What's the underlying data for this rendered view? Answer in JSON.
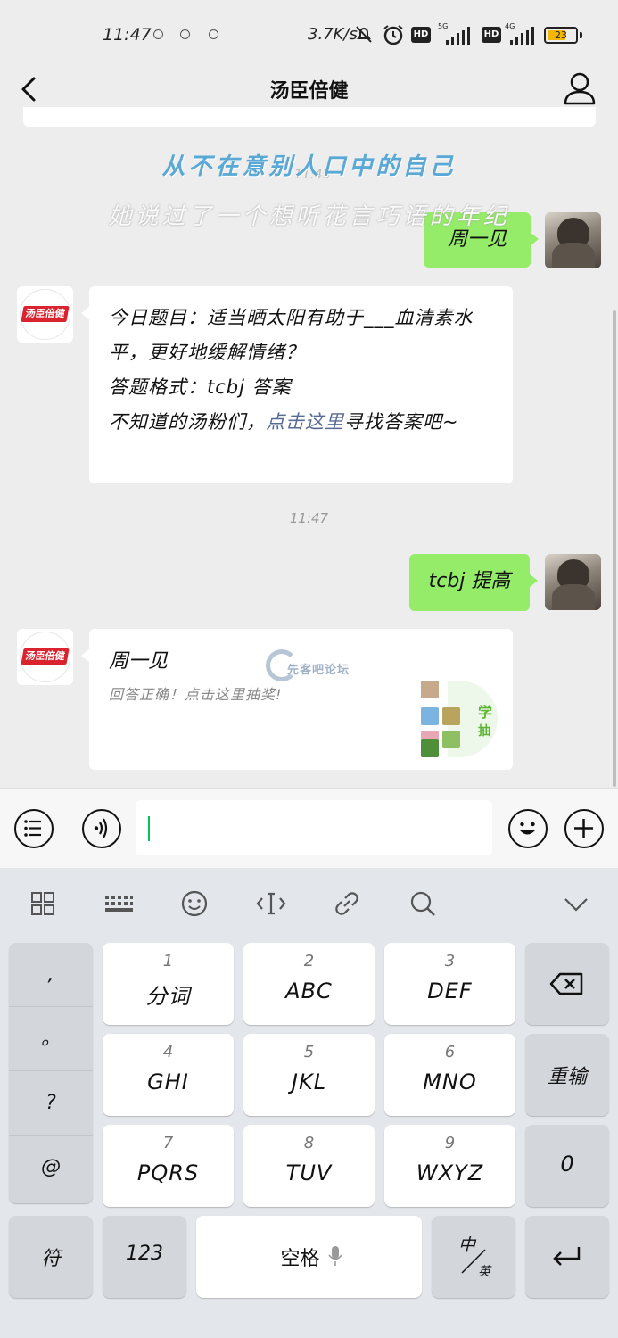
{
  "status_bar": {
    "time": "11:47",
    "net_speed": "3.7K/s",
    "hd1": "HD",
    "hd2": "HD",
    "net1": "5G",
    "net2": "4G",
    "battery": "23"
  },
  "nav": {
    "title": "汤臣倍健"
  },
  "overlay": {
    "line1": "从不在意别人口中的自己",
    "line2": "她说过了一个想听花言巧语的年纪",
    "faded_time": "11:43"
  },
  "messages": {
    "user_msg_1": "周一见",
    "bot_msg_1": {
      "line1": "今日题目：适当晒太阳有助于___血清素水平，更好地缓解情绪？",
      "line2": "答题格式：tcbj 答案",
      "line3_prefix": "不知道的汤粉们，",
      "line3_link": "点击这里",
      "line3_suffix": "寻找答案吧~"
    },
    "time_2": "11:47",
    "user_msg_2": "tcbj 提高",
    "card": {
      "title": "周一见",
      "desc": "回答正确！点击这里抽奖!",
      "thumb_text1": "学",
      "thumb_text2": "抽"
    },
    "brand_logo": "汤臣倍健"
  },
  "watermark": "先客吧论坛",
  "keyboard": {
    "punct": [
      ",",
      "。",
      "?",
      "@"
    ],
    "keys": [
      {
        "num": "1",
        "main": "分词"
      },
      {
        "num": "2",
        "main": "ABC"
      },
      {
        "num": "3",
        "main": "DEF"
      },
      {
        "num": "4",
        "main": "GHI"
      },
      {
        "num": "5",
        "main": "JKL"
      },
      {
        "num": "6",
        "main": "MNO"
      },
      {
        "num": "7",
        "main": "PQRS"
      },
      {
        "num": "8",
        "main": "TUV"
      },
      {
        "num": "9",
        "main": "WXYZ"
      }
    ],
    "reinput": "重输",
    "zero": "0",
    "symbol": "符",
    "numbers": "123",
    "space": "空格",
    "lang_top": "中",
    "lang_bottom": "英"
  },
  "colors": {
    "green_bubble": "#95ec69",
    "link": "#576b95",
    "cursor": "#07c160",
    "brand_red": "#d9232e"
  }
}
